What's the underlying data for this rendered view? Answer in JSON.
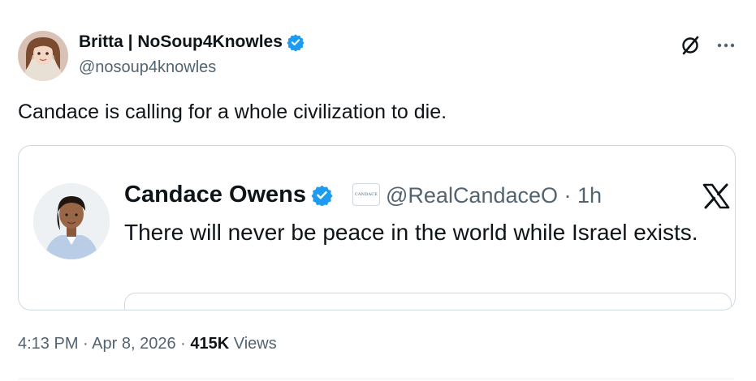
{
  "tweet": {
    "author": {
      "display_name": "Britta | NoSoup4Knowles",
      "handle": "@nosoup4knowles",
      "verified": true
    },
    "text": "Candace is calling for a whole civilization to die.",
    "timestamp": "4:13 PM · Apr 8, 2026 · ",
    "views_count": "415K",
    "views_label": " Views",
    "icons": {
      "grok": "grok-icon",
      "more": "more-icon",
      "verified": "verified-badge-icon"
    }
  },
  "embedded_screenshot": {
    "name": "Candace Owens",
    "verified": true,
    "badge_text": "CANDACE",
    "handle_time": "@RealCandaceO · 1h",
    "text": "There will never be peace in the world while Israel exists.",
    "logo": "x-logo-icon"
  },
  "colors": {
    "text_primary": "#0f1419",
    "text_secondary": "#536471",
    "verified_blue": "#1d9bf0",
    "border": "#cfd9de"
  }
}
